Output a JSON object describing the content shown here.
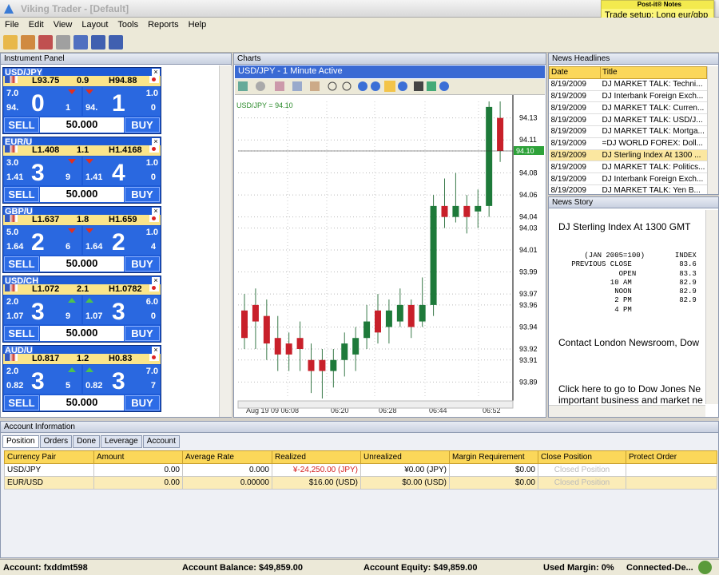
{
  "app": {
    "title": "Viking Trader - [Default]"
  },
  "menu": [
    "File",
    "Edit",
    "View",
    "Layout",
    "Tools",
    "Reports",
    "Help"
  ],
  "sticky_note": {
    "brand": "Post-it® Notes",
    "text": "Trade setup: Long eur/gbp 1.4109"
  },
  "instrument_panel": {
    "title": "Instrument Panel",
    "cards": [
      {
        "pair": "USD/JPY",
        "low": "L93.75",
        "spread": "0.9",
        "high": "H94.88",
        "bid_small": "7.0",
        "bid_pre": "94.",
        "bid_big": "0",
        "bid_sub": "1",
        "ask_small": "1.0",
        "ask_pre": "94.",
        "ask_big": "1",
        "ask_sub": "0",
        "sell": "SELL",
        "amount": "50.000",
        "buy": "BUY",
        "dir": "down"
      },
      {
        "pair": "EUR/U",
        "low": "L1.408",
        "spread": "1.1",
        "high": "H1.4168",
        "bid_small": "3.0",
        "bid_pre": "1.41",
        "bid_big": "3",
        "bid_sub": "9",
        "ask_small": "1.0",
        "ask_pre": "1.41",
        "ask_big": "4",
        "ask_sub": "0",
        "sell": "SELL",
        "amount": "50.000",
        "buy": "BUY",
        "dir": "down"
      },
      {
        "pair": "GBP/U",
        "low": "L1.637",
        "spread": "1.8",
        "high": "H1.659",
        "bid_small": "5.0",
        "bid_pre": "1.64",
        "bid_big": "2",
        "bid_sub": "6",
        "ask_small": "1.0",
        "ask_pre": "1.64",
        "ask_big": "2",
        "ask_sub": "4",
        "sell": "SELL",
        "amount": "50.000",
        "buy": "BUY",
        "dir": "down"
      },
      {
        "pair": "USD/CH",
        "low": "L1.072",
        "spread": "2.1",
        "high": "H1.0782",
        "bid_small": "2.0",
        "bid_pre": "1.07",
        "bid_big": "3",
        "bid_sub": "9",
        "ask_small": "6.0",
        "ask_pre": "1.07",
        "ask_big": "3",
        "ask_sub": "0",
        "sell": "SELL",
        "amount": "50.000",
        "buy": "BUY",
        "dir": "up"
      },
      {
        "pair": "AUD/U",
        "low": "L0.817",
        "spread": "1.2",
        "high": "H0.83",
        "bid_small": "2.0",
        "bid_pre": "0.82",
        "bid_big": "3",
        "bid_sub": "5",
        "ask_small": "7.0",
        "ask_pre": "0.82",
        "ask_big": "3",
        "ask_sub": "7",
        "sell": "SELL",
        "amount": "50.000",
        "buy": "BUY",
        "dir": "up"
      }
    ]
  },
  "charts": {
    "title": "Charts",
    "tab": "USD/JPY - 1 Minute Active",
    "legend": "USD/JPY = 94.10",
    "current": "94.10"
  },
  "chart_data": {
    "type": "candlestick",
    "title": "USD/JPY - 1 Minute Active",
    "y_ticks": [
      "94.13",
      "94.11",
      "94.10",
      "94.08",
      "94.06",
      "94.04",
      "94.03",
      "94.01",
      "93.99",
      "93.97",
      "93.96",
      "93.94",
      "93.92",
      "93.91",
      "93.89"
    ],
    "x_ticks": [
      "Aug 19 09 06:08",
      "06:20",
      "06:28",
      "06:44",
      "06:52"
    ],
    "ylim": [
      93.875,
      94.145
    ],
    "candles": [
      [
        93.955,
        93.93,
        93.97,
        93.92,
        "d"
      ],
      [
        93.96,
        93.945,
        93.975,
        93.92,
        "d"
      ],
      [
        93.95,
        93.925,
        93.965,
        93.91,
        "d"
      ],
      [
        93.93,
        93.915,
        93.95,
        93.9,
        "d"
      ],
      [
        93.925,
        93.915,
        93.935,
        93.9,
        "d"
      ],
      [
        93.93,
        93.92,
        93.945,
        93.9,
        "d"
      ],
      [
        93.91,
        93.9,
        93.925,
        93.88,
        "d"
      ],
      [
        93.91,
        93.9,
        93.92,
        93.875,
        "d"
      ],
      [
        93.9,
        93.91,
        93.92,
        93.885,
        "u"
      ],
      [
        93.91,
        93.925,
        93.935,
        93.895,
        "u"
      ],
      [
        93.915,
        93.93,
        93.94,
        93.9,
        "u"
      ],
      [
        93.93,
        93.945,
        93.96,
        93.92,
        "u"
      ],
      [
        93.955,
        93.935,
        93.97,
        93.925,
        "d"
      ],
      [
        93.94,
        93.955,
        93.965,
        93.925,
        "u"
      ],
      [
        93.945,
        93.96,
        93.975,
        93.94,
        "u"
      ],
      [
        93.96,
        93.94,
        93.965,
        93.93,
        "d"
      ],
      [
        93.945,
        93.96,
        93.985,
        93.94,
        "u"
      ],
      [
        93.96,
        94.05,
        94.06,
        93.95,
        "u"
      ],
      [
        94.05,
        94.04,
        94.075,
        94.03,
        "d"
      ],
      [
        94.04,
        94.05,
        94.08,
        94.035,
        "u"
      ],
      [
        94.05,
        94.04,
        94.06,
        94.025,
        "d"
      ],
      [
        94.045,
        94.05,
        94.065,
        94.03,
        "u"
      ],
      [
        94.05,
        94.14,
        94.145,
        94.04,
        "u"
      ],
      [
        94.13,
        94.1,
        94.145,
        94.09,
        "d"
      ]
    ]
  },
  "news": {
    "title": "News Headlines",
    "headers": [
      "Date",
      "Title"
    ],
    "rows": [
      [
        "8/19/2009",
        "DJ MARKET TALK: Techni..."
      ],
      [
        "8/19/2009",
        "DJ Interbank Foreign Exch..."
      ],
      [
        "8/19/2009",
        "DJ MARKET TALK: Curren..."
      ],
      [
        "8/19/2009",
        "DJ MARKET TALK: USD/J..."
      ],
      [
        "8/19/2009",
        "DJ MARKET TALK: Mortga..."
      ],
      [
        "8/19/2009",
        "=DJ WORLD FOREX: Doll..."
      ],
      [
        "8/19/2009",
        "DJ Sterling Index At 1300 ..."
      ],
      [
        "8/19/2009",
        "DJ MARKET TALK: Politics..."
      ],
      [
        "8/19/2009",
        "DJ Interbank Foreign Exch..."
      ],
      [
        "8/19/2009",
        "DJ MARKET TALK: Yen B..."
      ]
    ],
    "selected": 6
  },
  "story": {
    "title": "News Story",
    "headline": "DJ Sterling Index At 1300 GMT",
    "body": "      (JAN 2005=100)       INDEX\n   PREVIOUS CLOSE           83.6\n              OPEN          83.3\n            10 AM           82.9\n             NOON           82.9\n             2 PM           82.9\n             4 PM",
    "contact": "Contact London Newsroom, Dow",
    "click1": "Click here to go to Dow Jones Ne",
    "click2": "important business and market ne"
  },
  "account": {
    "title": "Account Information",
    "tabs": [
      "Position",
      "Orders",
      "Done",
      "Leverage",
      "Account"
    ],
    "headers": [
      "Currency Pair",
      "Amount",
      "Average Rate",
      "Realized",
      "Unrealized",
      "Margin Requirement",
      "Close Position",
      "Protect Order"
    ],
    "rows": [
      [
        "USD/JPY",
        "0.00",
        "0.000",
        "¥-24,250.00 (JPY)",
        "¥0.00 (JPY)",
        "$0.00",
        "Closed Position",
        ""
      ],
      [
        "EUR/USD",
        "0.00",
        "0.00000",
        "$16.00 (USD)",
        "$0.00 (USD)",
        "$0.00",
        "Closed Position",
        ""
      ]
    ]
  },
  "status": {
    "account": "Account:  fxddmt598",
    "balance": "Account Balance:  $49,859.00",
    "equity": "Account Equity:  $49,859.00",
    "margin": "Used Margin:  0%",
    "conn": "Connected-De..."
  }
}
